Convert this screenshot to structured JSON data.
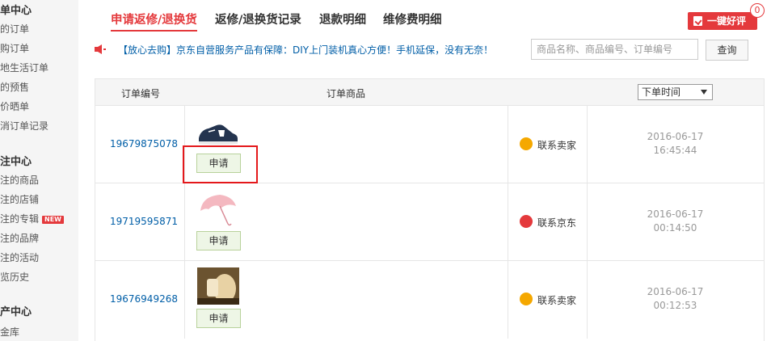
{
  "sidebar": {
    "groups": [
      {
        "title": "单中心",
        "items": [
          "的订单",
          "购订单",
          "地生活订单",
          "的预售",
          "价晒单",
          "消订单记录"
        ]
      },
      {
        "title": "注中心",
        "items": [
          "注的商品",
          "注的店铺",
          "注的专辑",
          "注的品牌",
          "注的活动",
          "览历史"
        ]
      },
      {
        "title": "产中心",
        "items": [
          "金库"
        ]
      }
    ],
    "new_badge": "NEW"
  },
  "tabs": [
    "申请返修/退换货",
    "返修/退换货记录",
    "退款明细",
    "维修费明细"
  ],
  "active_tab": 0,
  "review": {
    "label": "一键好评",
    "count": "0"
  },
  "notice": {
    "text": "【放心去购】京东自营服务产品有保障：DIY上门装机真心方便！手机延保，没有无奈！"
  },
  "search": {
    "placeholder": "商品名称、商品编号、订单编号",
    "button": "查询"
  },
  "table": {
    "headers": {
      "order_no": "订单编号",
      "product": "订单商品"
    },
    "sort": {
      "selected": "下单时间"
    },
    "rows": [
      {
        "order_no": "19679875078",
        "product_icon": "sneaker-image",
        "apply": "申请",
        "contact": "联系卖家",
        "contact_color": "#f5a800",
        "date": "2016-06-17",
        "time": "16:45:44"
      },
      {
        "order_no": "19719595871",
        "product_icon": "umbrella-image",
        "apply": "申请",
        "contact": "联系京东",
        "contact_color": "#e4393c",
        "date": "2016-06-17",
        "time": "00:14:50"
      },
      {
        "order_no": "19676949268",
        "product_icon": "night-light-image",
        "apply": "申请",
        "contact": "联系卖家",
        "contact_color": "#f5a800",
        "date": "2016-06-17",
        "time": "00:12:53"
      }
    ]
  },
  "colors": {
    "accent": "#e4393c",
    "link": "#005ea7",
    "highlight": "#e4181b"
  }
}
